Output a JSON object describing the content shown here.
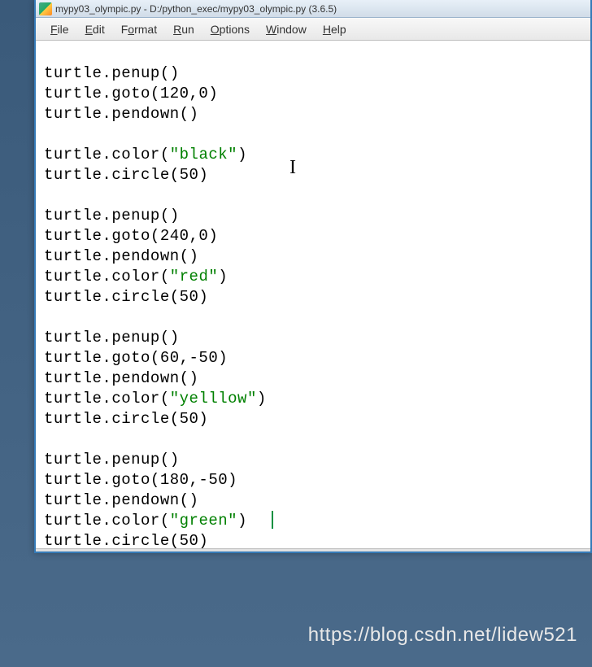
{
  "title": "mypy03_olympic.py - D:/python_exec/mypy03_olympic.py (3.6.5)",
  "menu": {
    "file": "File",
    "edit": "Edit",
    "format": "Format",
    "run": "Run",
    "options": "Options",
    "window": "Window",
    "help": "Help"
  },
  "code": {
    "l0": "turtle.penup()",
    "l1": "turtle.goto(120,0)",
    "l2": "turtle.pendown()",
    "l3": "",
    "l4_pre": "turtle.color(",
    "l4_str": "\"black\"",
    "l4_post": ")",
    "l5": "turtle.circle(50)",
    "l6": "",
    "l7": "turtle.penup()",
    "l8": "turtle.goto(240,0)",
    "l9": "turtle.pendown()",
    "l10_pre": "turtle.color(",
    "l10_str": "\"red\"",
    "l10_post": ")",
    "l11": "turtle.circle(50)",
    "l12": "",
    "l13": "turtle.penup()",
    "l14": "turtle.goto(60,-50)",
    "l15": "turtle.pendown()",
    "l16_pre": "turtle.color(",
    "l16_str": "\"yelllow\"",
    "l16_post": ")",
    "l17": "turtle.circle(50)",
    "l18": "",
    "l19": "turtle.penup()",
    "l20": "turtle.goto(180,-50)",
    "l21": "turtle.pendown()",
    "l22_pre": "turtle.color(",
    "l22_str": "\"green\"",
    "l22_post": ")",
    "l23": "turtle.circle(50)"
  },
  "watermark": "https://blog.csdn.net/lidew521"
}
